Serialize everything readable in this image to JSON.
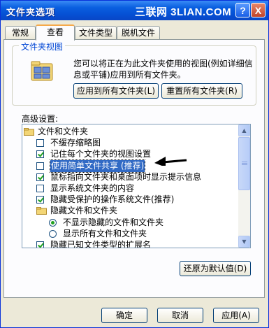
{
  "window": {
    "title": "文件夹选项",
    "watermark": "三联网 3LIAN.COM",
    "help_label": "?",
    "close_label": "X"
  },
  "tabs": [
    "常规",
    "查看",
    "文件类型",
    "脱机文件"
  ],
  "active_tab": "查看",
  "folder_views": {
    "label": "文件夹视图",
    "description": "您可以将正在为此文件夹使用的视图(例如详细信息或平铺)应用到所有文件夹。",
    "apply_all_button": "应用到所有文件夹(L)",
    "reset_all_button": "重置所有文件夹(R)"
  },
  "advanced": {
    "label": "高级设置:",
    "items": [
      {
        "type": "folder",
        "text": "文件和文件夹",
        "level": 0
      },
      {
        "type": "checkbox",
        "text": "不缓存缩略图",
        "checked": false,
        "level": 1
      },
      {
        "type": "checkbox",
        "text": "记住每个文件夹的视图设置",
        "checked": true,
        "level": 1
      },
      {
        "type": "checkbox",
        "text": "使用简单文件共享 (推荐)",
        "checked": false,
        "level": 1,
        "selected": true
      },
      {
        "type": "checkbox",
        "text": "鼠标指向文件夹和桌面项时显示提示信息",
        "checked": true,
        "level": 1
      },
      {
        "type": "checkbox",
        "text": "显示系统文件夹的内容",
        "checked": false,
        "level": 1
      },
      {
        "type": "checkbox",
        "text": "隐藏受保护的操作系统文件(推荐)",
        "checked": true,
        "level": 1
      },
      {
        "type": "folder",
        "text": "隐藏文件和文件夹",
        "level": 1
      },
      {
        "type": "radio",
        "text": "不显示隐藏的文件和文件夹",
        "checked": true,
        "level": 2
      },
      {
        "type": "radio",
        "text": "显示所有文件和文件夹",
        "checked": false,
        "level": 2
      },
      {
        "type": "checkbox",
        "text": "隐藏已知文件类型的扩展名",
        "checked": true,
        "level": 1
      }
    ],
    "restore_defaults_button": "还原为默认值(D)"
  },
  "footer": {
    "ok": "确定",
    "cancel": "取消",
    "apply": "应用(A)"
  },
  "colors": {
    "titlebar": "#0550d4",
    "selection": "#316ac5",
    "group_label": "#0046d5",
    "check": "#21a121"
  }
}
